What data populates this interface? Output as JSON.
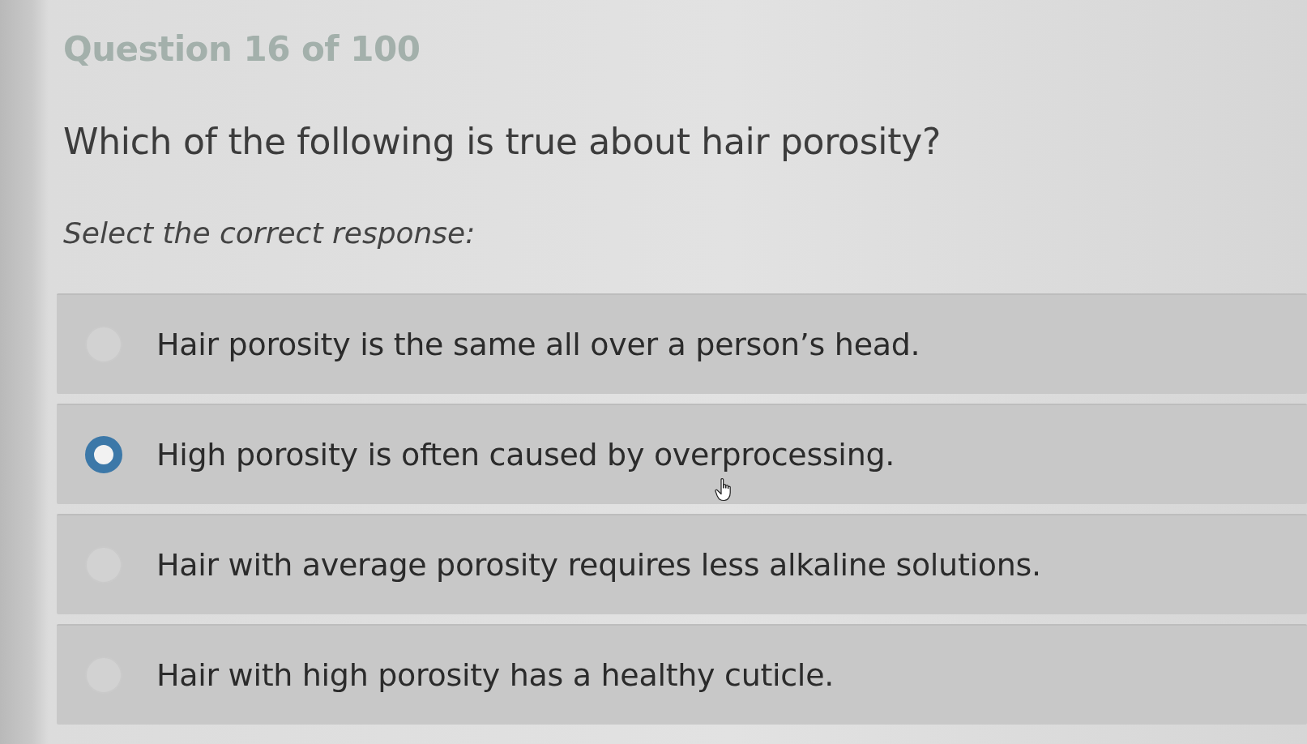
{
  "quiz": {
    "progress": "Question 16 of 100",
    "question": "Which of the following is true about hair porosity?",
    "instruction": "Select the correct response:",
    "options": [
      {
        "text": "Hair porosity is the same all over a person’s head.",
        "selected": false
      },
      {
        "text": "High porosity is often caused by overprocessing.",
        "selected": true
      },
      {
        "text": "Hair with average porosity requires less alkaline solutions.",
        "selected": false
      },
      {
        "text": "Hair with high porosity has a healthy cuticle.",
        "selected": false
      }
    ]
  }
}
